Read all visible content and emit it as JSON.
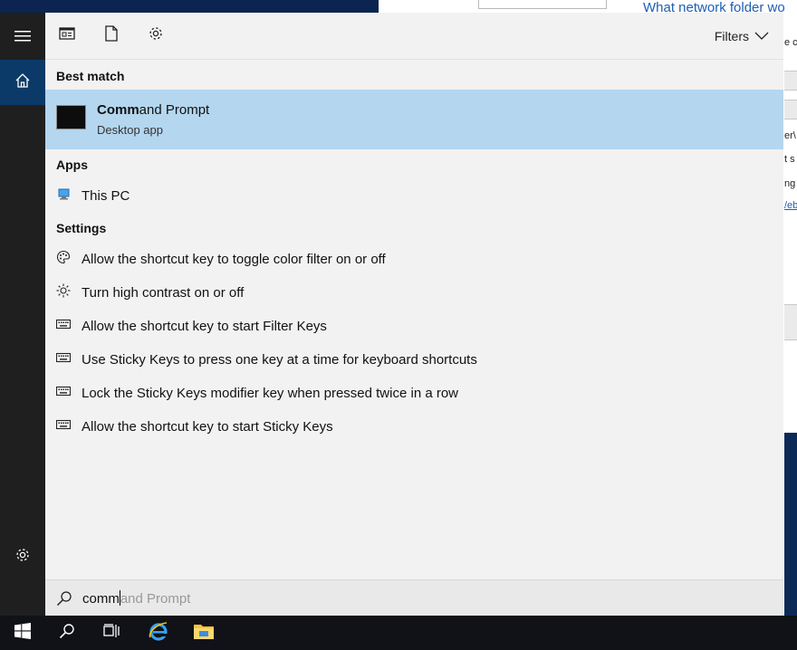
{
  "background": {
    "link_text": "What network folder wo",
    "fragments": [
      "e c",
      "er\\",
      "t s",
      "ng",
      "/eb"
    ]
  },
  "rail": {
    "menu_icon": "hamburger-icon",
    "home_icon": "home-icon",
    "settings_icon": "gear-icon"
  },
  "toolbar": {
    "icons": [
      "document-preview-icon",
      "document-icon",
      "gear-icon"
    ],
    "filters_label": "Filters"
  },
  "sections": {
    "best_match": "Best match",
    "apps": "Apps",
    "settings": "Settings"
  },
  "best_match": {
    "name_bold": "Comm",
    "name_rest": "and Prompt",
    "subtitle": "Desktop app",
    "highlight_color": "#b4d6ef"
  },
  "apps": [
    {
      "label": "This PC",
      "icon": "this-pc-icon"
    }
  ],
  "settings": [
    {
      "label": "Allow the shortcut key to toggle color filter on or off",
      "icon": "palette-icon"
    },
    {
      "label": "Turn high contrast on or off",
      "icon": "brightness-icon"
    },
    {
      "label": "Allow the shortcut key to start Filter Keys",
      "icon": "keyboard-icon"
    },
    {
      "label": "Use Sticky Keys to press one key at a time for keyboard shortcuts",
      "icon": "keyboard-icon"
    },
    {
      "label": "Lock the Sticky Keys modifier key when pressed twice in a row",
      "icon": "keyboard-icon"
    },
    {
      "label": "Allow the shortcut key to start Sticky Keys",
      "icon": "keyboard-icon"
    }
  ],
  "search": {
    "typed": "comm",
    "suggestion": "and Prompt"
  },
  "taskbar": {
    "items": [
      "windows-start-icon",
      "search-icon",
      "task-view-icon",
      "internet-explorer-icon",
      "file-explorer-icon"
    ]
  }
}
